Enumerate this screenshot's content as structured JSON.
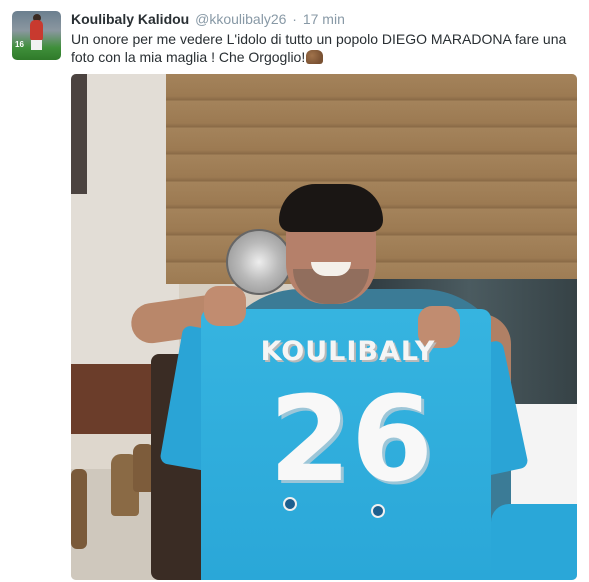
{
  "tweet": {
    "display_name": "Koulibaly Kalidou",
    "handle": "@kkoulibaly26",
    "separator": "·",
    "timestamp": "17 min",
    "text": "Un onore per me vedere L'idolo di tutto un popolo DIEGO MARADONA fare una foto con la mia maglia ! Che Orgoglio!",
    "emoji_icon": "raised-hands-emoji",
    "avatar_icon": "profile-avatar"
  },
  "media": {
    "jersey_name": "KOULIBALY",
    "jersey_number": "26",
    "avatar_number": "16"
  },
  "colors": {
    "handle_gray": "#8899a6",
    "text": "#292f33",
    "jersey_blue": "#2aa7d8"
  }
}
